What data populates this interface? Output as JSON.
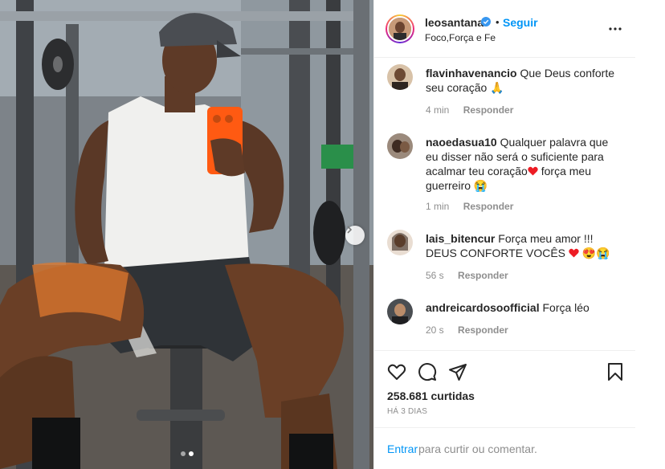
{
  "header": {
    "username": "leosantana",
    "separator": "•",
    "follow_label": "Seguir",
    "location": "Foco,Força e Fe"
  },
  "comments": [
    {
      "username": "flavinhavenancio",
      "text": "Que Deus conforte seu coração",
      "emoji": "🙏",
      "time": "4 min",
      "reply": "Responder"
    },
    {
      "username": "naoedasua10",
      "text": "Qualquer palavra que eu disser não será o suficiente para acalmar teu coração",
      "text2": "força meu guerreiro",
      "emoji": "😭",
      "time": "1 min",
      "reply": "Responder"
    },
    {
      "username": "lais_bitencur",
      "text": "Força meu amor !!! DEUS CONFORTE VOCÊS",
      "emoji": "😍😭",
      "time": "56 s",
      "reply": "Responder"
    },
    {
      "username": "andreicardosoofficial",
      "text": "Força léo",
      "time": "20 s",
      "reply": "Responder"
    }
  ],
  "actions": {
    "icons": [
      "heart-icon",
      "comment-icon",
      "share-icon",
      "bookmark-icon"
    ]
  },
  "likes": "258.681 curtidas",
  "date": "HÁ 3 DIAS",
  "login": {
    "enter_label": "Entrar",
    "rest_text": "para curtir ou comentar."
  },
  "colors": {
    "link": "#0095f6",
    "text": "#262626",
    "muted": "#8e8e8e",
    "heart": "#ed1c24"
  }
}
